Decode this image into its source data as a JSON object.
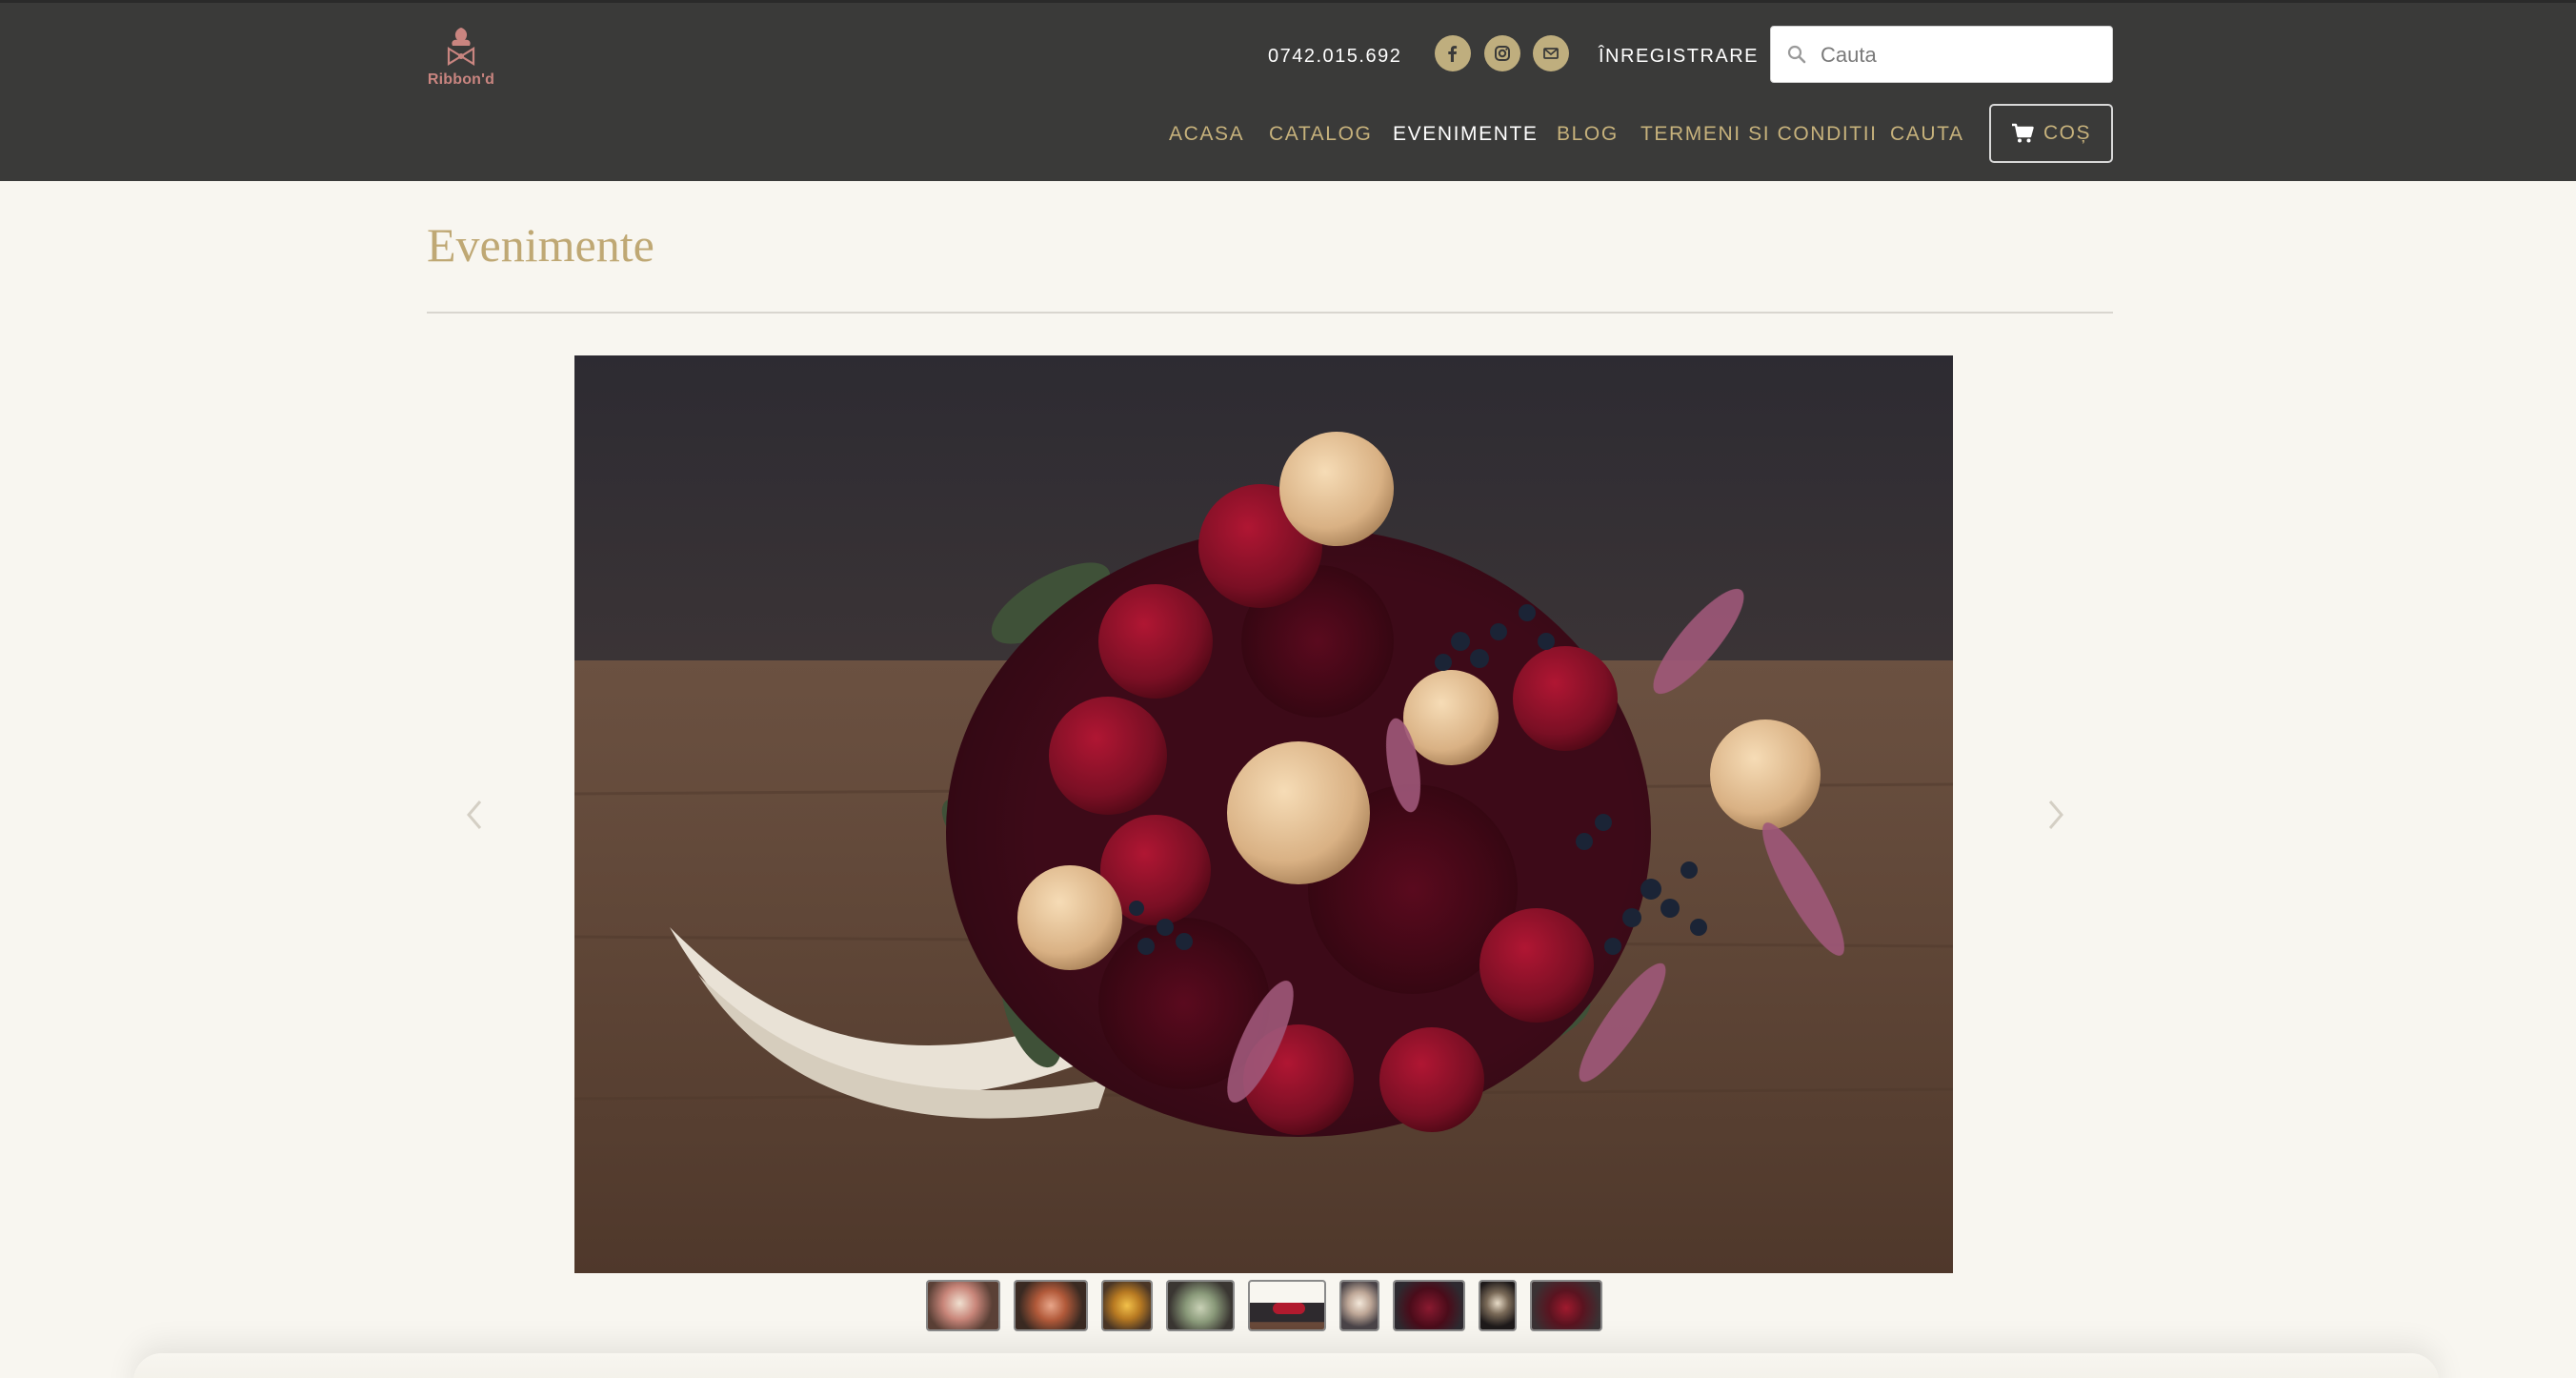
{
  "header": {
    "logo_text": "Ribbon'd",
    "phone": "0742.015.692",
    "social": [
      {
        "icon": "facebook-icon"
      },
      {
        "icon": "instagram-icon"
      },
      {
        "icon": "mail-icon"
      }
    ],
    "register_label": "ÎNREGISTRARE",
    "search_placeholder": "Cauta",
    "nav": [
      {
        "label": "ACASA",
        "active": false
      },
      {
        "label": "CATALOG",
        "active": false
      },
      {
        "label": "EVENIMENTE",
        "active": true
      },
      {
        "label": "BLOG",
        "active": false
      },
      {
        "label": "TERMENI SI CONDITII",
        "active": false
      },
      {
        "label": "CAUTA",
        "active": false
      }
    ],
    "cart_label": "COȘ"
  },
  "main": {
    "title": "Evenimente",
    "gallery": {
      "hero_image": "bouquet-photo",
      "thumbnail_count": 9
    }
  },
  "colors": {
    "header_bg": "#3a3a39",
    "accent_gold": "#c7b27c",
    "page_bg": "#f8f6f0",
    "title_gold": "#bfa874"
  }
}
